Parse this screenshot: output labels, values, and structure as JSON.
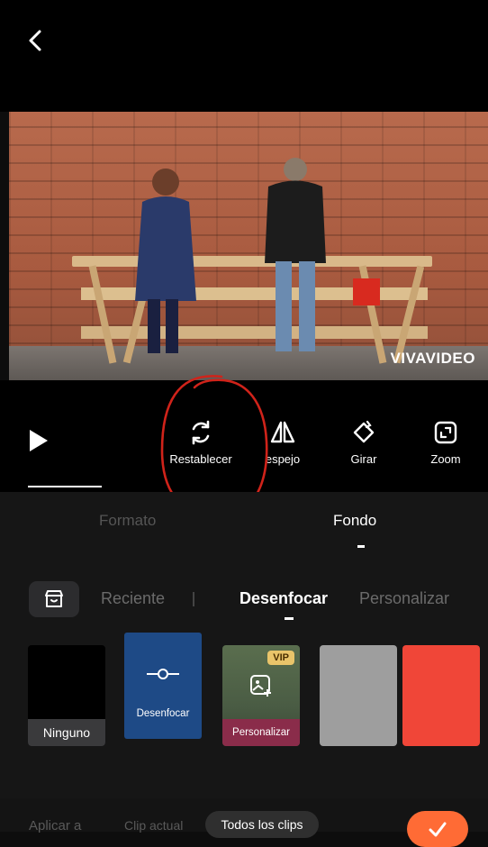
{
  "header": {
    "back_icon": "chevron-left-icon"
  },
  "preview": {
    "watermark": "VIVAVIDEO"
  },
  "toolbar": {
    "play_icon": "play-icon",
    "tools": [
      {
        "label": "Restablecer",
        "icon": "reset-icon"
      },
      {
        "label": "espejo",
        "icon": "mirror-icon"
      },
      {
        "label": "Girar",
        "icon": "rotate-icon"
      },
      {
        "label": "Zoom",
        "icon": "zoom-icon"
      }
    ]
  },
  "tabs": [
    {
      "label": "Formato",
      "active": false
    },
    {
      "label": "Fondo",
      "active": true
    }
  ],
  "categories": {
    "store_icon": "store-icon",
    "items": [
      {
        "label": "Reciente",
        "active": false
      },
      {
        "label": "Desenfocar",
        "active": true
      },
      {
        "label": "Personalizar",
        "active": false
      }
    ]
  },
  "backgrounds": [
    {
      "label": "Ninguno",
      "color": "#000000"
    },
    {
      "label": "Desenfocar",
      "color": "#1e4a86",
      "icon": "slider-icon"
    },
    {
      "label": "Personalizar",
      "badge": "VIP",
      "icon": "add-image-icon"
    },
    {
      "label": "",
      "color": "#9e9e9e"
    },
    {
      "label": "",
      "color": "#f04638"
    }
  ],
  "apply": {
    "label": "Aplicar a",
    "options": [
      {
        "label": "Clip actual",
        "selected": false
      },
      {
        "label": "Todos los clips",
        "selected": true
      }
    ],
    "confirm_icon": "check-icon",
    "accent": "#ff6b35"
  }
}
